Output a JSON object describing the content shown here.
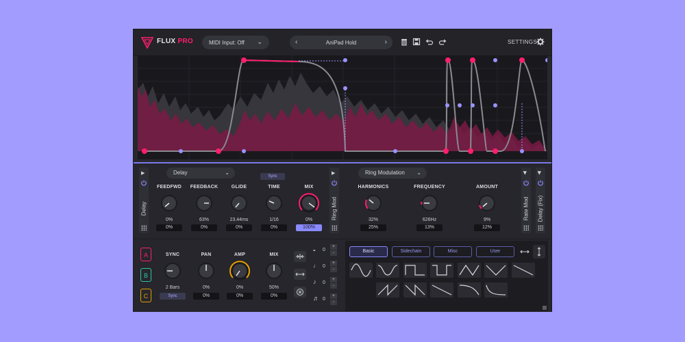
{
  "header": {
    "logo_text": "FLUX",
    "logo_pro": "PRO",
    "midi_input": "MIDI Input: Off",
    "preset_name": "AniPad Hold",
    "settings_label": "SETTINGS",
    "icons": [
      "trash-icon",
      "save-icon",
      "undo-icon",
      "redo-icon",
      "gear-icon"
    ]
  },
  "colors": {
    "accent": "#ff1f6b",
    "purple": "#9a93ff",
    "panel": "#27272d",
    "background": "#a29cff"
  },
  "fx_left": {
    "side_label": "Delay",
    "dropdown": "Delay",
    "sync_button": "Sync",
    "knobs": [
      {
        "label": "FEEDFWD",
        "value": "0%",
        "field": "0%"
      },
      {
        "label": "FEEDBACK",
        "value": "63%",
        "field": "0%"
      },
      {
        "label": "GLIDE",
        "value": "23.44ms",
        "field": "0%"
      },
      {
        "label": "TIME",
        "value": "1/16",
        "field": "0%"
      },
      {
        "label": "MIX",
        "value": "0%",
        "field": "100%"
      }
    ]
  },
  "fx_right": {
    "side_label": "Ring Mod",
    "dropdown": "Ring Modulation",
    "knobs": [
      {
        "label": "HARMONICS",
        "value": "32%",
        "field": "25%"
      },
      {
        "label": "FREQUENCY",
        "value": "626Hz",
        "field": "13%"
      },
      {
        "label": "AMOUNT",
        "value": "9%",
        "field": "12%"
      }
    ]
  },
  "side_tabs": [
    "Rate Mod",
    "Delay (Fix)"
  ],
  "lower": {
    "channels": [
      "A",
      "B",
      "C"
    ],
    "sync_button": "Sync",
    "knobs": [
      {
        "label": "SYNC",
        "value": "2 Bars",
        "field": "Sync"
      },
      {
        "label": "PAN",
        "value": "0%",
        "field": "0%"
      },
      {
        "label": "AMP",
        "value": "0%",
        "field": "0%"
      },
      {
        "label": "MIX",
        "value": "50%",
        "field": "0%"
      }
    ],
    "note_values": [
      "0",
      "0",
      "0",
      "0"
    ]
  },
  "wave_panel": {
    "tabs": [
      "Basic",
      "Sidechain",
      "Misc",
      "User"
    ],
    "active_tab": "Basic",
    "icons": [
      "flip-horizontal-icon",
      "flip-vertical-icon"
    ]
  }
}
